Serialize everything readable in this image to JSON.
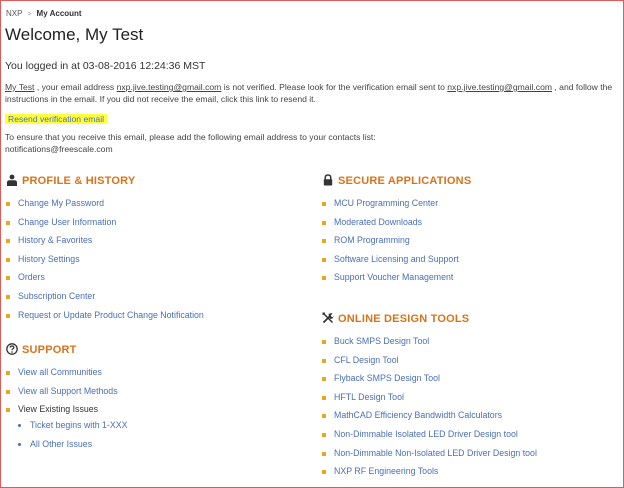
{
  "breadcrumb": {
    "root": "NXP",
    "separator": ">",
    "current": "My Account"
  },
  "welcome": "Welcome, My Test",
  "logged_in": "You logged in at 03-08-2016 12:24:36 MST",
  "verify": {
    "name": "My Test",
    "text1": " , your email address ",
    "email": "nxp.jive.testing@gmail.com",
    "text2": " is not verified. Please look for the verification email sent to ",
    "email2": "nxp.jive.testing@gmail.com",
    "text3": " , and follow the instructions in the email. If you did not receive the email, click this link to resend it."
  },
  "resend_link": "Resend verification email",
  "ensure_text": "To ensure that you receive this email, please add the following email address to your contacts list:",
  "ensure_email": "notifications@freescale.com",
  "profile": {
    "title": "PROFILE & HISTORY",
    "icon": "user-icon",
    "items": [
      "Change My Password",
      "Change User Information",
      "History & Favorites",
      "History Settings",
      "Orders",
      "Subscription Center",
      "Request or Update Product Change Notification"
    ]
  },
  "support": {
    "title": "SUPPORT",
    "icon": "question-circle-icon",
    "items": [
      "View all Communities",
      "View all Support Methods",
      "View Existing Issues"
    ],
    "sub_items": [
      "Ticket begins with 1-XXX",
      "All Other Issues"
    ]
  },
  "secure": {
    "title": "SECURE APPLICATIONS",
    "icon": "lock-icon",
    "items": [
      "MCU Programming Center",
      "Moderated Downloads",
      "ROM Programming",
      "Software Licensing and Support",
      "Support Voucher Management"
    ]
  },
  "tools": {
    "title": "ONLINE DESIGN TOOLS",
    "icon": "tools-icon",
    "items": [
      "Buck SMPS Design Tool",
      "CFL Design Tool",
      "Flyback SMPS Design Tool",
      "HFTL Design Tool",
      "MathCAD Efficiency Bandwidth Calculators",
      "Non-Dimmable Isolated LED Driver Design tool",
      "Non-Dimmable Non-Isolated LED Driver Design tool",
      "NXP RF Engineering Tools"
    ]
  },
  "colors": {
    "accent": "#d9731a",
    "link": "#4a6fb5",
    "bullet": "#e8a81c",
    "highlight": "#ffff3d",
    "frame": "#e05a5a"
  }
}
